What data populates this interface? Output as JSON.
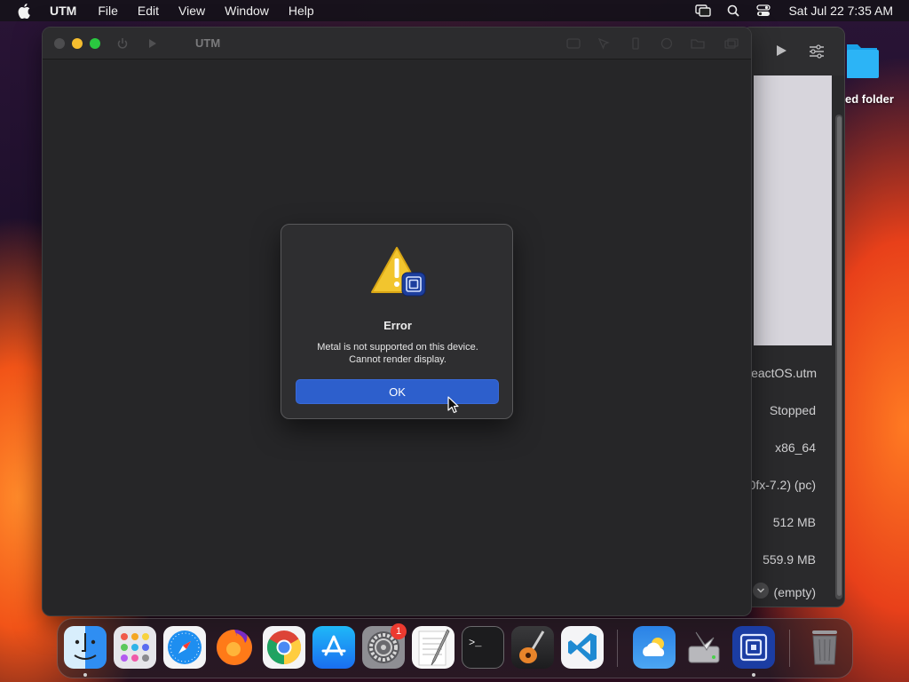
{
  "menubar": {
    "app_name": "UTM",
    "items": [
      "File",
      "Edit",
      "View",
      "Window",
      "Help"
    ],
    "clock": "Sat Jul 22  7:35 AM"
  },
  "desktop": {
    "folder_label": "ed folder"
  },
  "window": {
    "title": "UTM"
  },
  "vm_info": {
    "name": "eactOS.utm",
    "status": "Stopped",
    "architecture": "x86_64",
    "machine": "0fx-7.2) (pc)",
    "memory": "512 MB",
    "size": "559.9 MB",
    "cd": "(empty)"
  },
  "alert": {
    "title": "Error",
    "message_line1": "Metal is not supported on this device.",
    "message_line2": "Cannot render display.",
    "ok_label": "OK"
  },
  "dock": {
    "apps": [
      "finder",
      "launchpad",
      "safari",
      "firefox",
      "chrome",
      "app-store",
      "system-settings",
      "textedit",
      "terminal",
      "garageband",
      "vscode",
      "weather",
      "disk-utility",
      "utm",
      "trash"
    ],
    "system_settings_badge": "1"
  }
}
